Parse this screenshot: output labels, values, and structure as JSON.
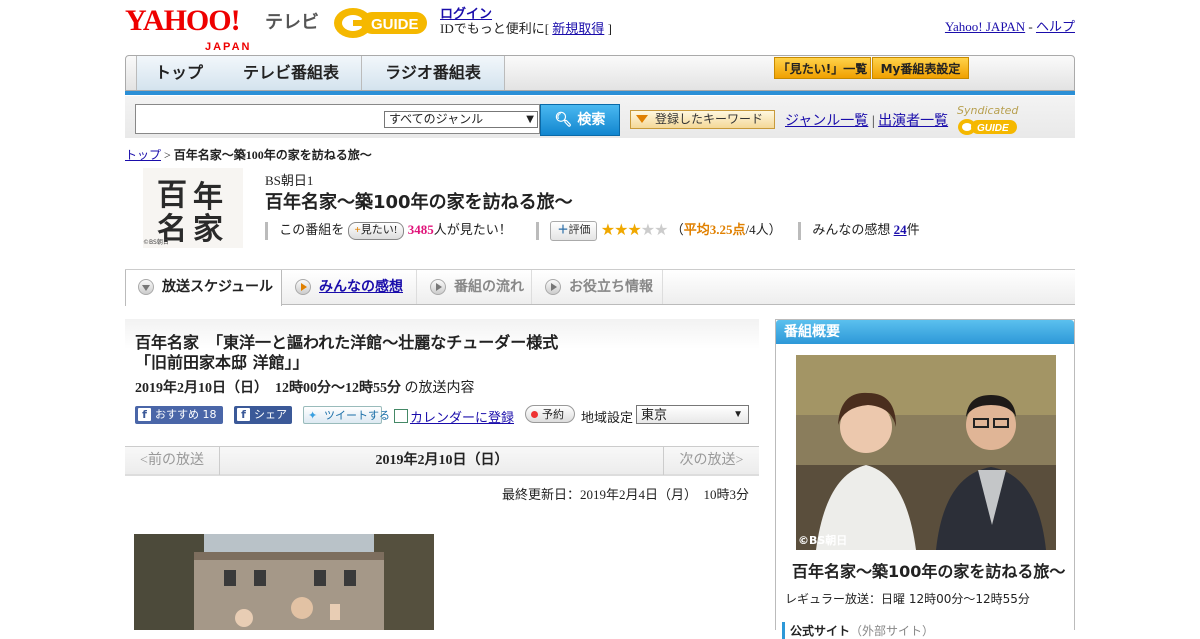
{
  "header": {
    "yahoo_logo": "YAHOO!",
    "yahoo_sub": "JAPAN",
    "tv_label": "テレビ",
    "guide_logo": "GUIDE",
    "login": "ログイン",
    "login_msg": "IDでもっと便利に[",
    "signup": "新規取得",
    "login_msg_end": "]",
    "yahoo_japan_link": "Yahoo! JAPAN",
    "dash": "-",
    "help_link": "ヘルプ"
  },
  "nav": {
    "tabs": [
      "トップ",
      "テレビ番組表",
      "ラジオ番組表"
    ],
    "want_list": "「見たい!」一覧",
    "my_schedule": "My番組表設定"
  },
  "search": {
    "genre_selected": "すべてのジャンル",
    "search_btn": "検索",
    "keyword_btn": "登録したキーワード",
    "genre_list": "ジャンル一覧",
    "separator": "|",
    "cast_list": "出演者一覧",
    "syndicated": "Syndicated"
  },
  "breadcrumb": {
    "top": "トップ",
    "sep": ">",
    "current": "百年名家～築100年の家を訪ねる旅～"
  },
  "program": {
    "thumb_chars": [
      "百",
      "年",
      "名",
      "家"
    ],
    "thumb_copyright": "©BS朝日",
    "channel": "BS朝日1",
    "title": "百年名家～築100年の家を訪ねる旅～",
    "this_program": "この番組を",
    "want_btn": "見たい!",
    "want_count": "3485",
    "want_suffix": "人が見たい！",
    "rating_btn": "評価",
    "rating_stars": 3,
    "rating_paren_open": "（",
    "rating_avg": "平均3.25点",
    "rating_people": "/4人）",
    "impressions_label": "みんなの感想",
    "impressions_count": "24",
    "impressions_suffix": "件"
  },
  "subtabs": [
    "放送スケジュール",
    "みんなの感想",
    "番組の流れ",
    "お役立ち情報"
  ],
  "episode": {
    "title_line1": "百年名家　「東洋一と謳われた洋館～壮麗なチューダー様式",
    "title_line2": "「旧前田家本邸 洋館」」",
    "date": "2019年2月10日（日）　12時00分～12時55分",
    "date_suffix": "の放送内容",
    "fb_recommend": "おすすめ",
    "fb_recommend_count": "18",
    "fb_share": "シェア",
    "tweet": "ツイートする",
    "calendar": "カレンダーに登録",
    "reserve": "予約",
    "region_label": "地域設定",
    "region_value": "東京"
  },
  "pager": {
    "prev": "<前の放送",
    "current": "2019年2月10日（日）",
    "next": "次の放送>"
  },
  "updated": "最終更新日：2019年2月4日（月）　10時3分",
  "sidebar": {
    "heading": "番組概要",
    "photo_copyright": "©BS朝日",
    "title": "百年名家～築100年の家を訪ねる旅～",
    "regular": "レギュラー放送：日曜 12時00分～12時55分",
    "official_site": "公式サイト",
    "external": "（外部サイト）"
  }
}
